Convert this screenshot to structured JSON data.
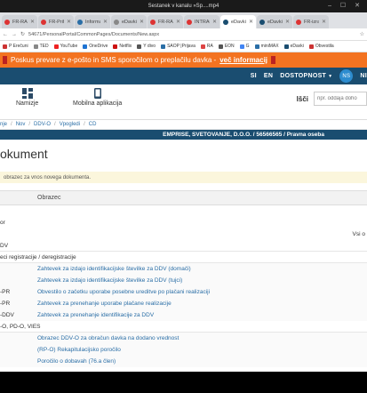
{
  "window": {
    "title": "Sestanek v kanalu »Sp....mp4",
    "controls": "– ☐ ✕"
  },
  "tabs": [
    {
      "label": "FR-RAČUNOVO",
      "color": "#d33",
      "active": false
    },
    {
      "label": "FR-Prihod",
      "color": "#d33",
      "active": false
    },
    {
      "label": "Informacije",
      "color": "#2a6ea6",
      "active": false
    },
    {
      "label": "eDavki.jpg",
      "color": "#888",
      "active": false
    },
    {
      "label": "FR-RAČUN",
      "color": "#d33",
      "active": false
    },
    {
      "label": "INTRACOM",
      "color": "#d33",
      "active": false
    },
    {
      "label": "eDavki - Nov",
      "color": "#1a4d70",
      "active": true
    },
    {
      "label": "eDavki - Nov",
      "color": "#1a4d70",
      "active": false
    },
    {
      "label": "FR-izračun P",
      "color": "#d33",
      "active": false
    }
  ],
  "address": {
    "url": "54671/PersonalPortal/CommonPages/Documents/New.aspx"
  },
  "bookmarks": [
    {
      "label": "P Erečuni",
      "color": "#c33"
    },
    {
      "label": "TED",
      "color": "#888"
    },
    {
      "label": "YouTube",
      "color": "#e22"
    },
    {
      "label": "OneDrive",
      "color": "#1e73d2"
    },
    {
      "label": "Netflix",
      "color": "#c11"
    },
    {
      "label": "Y divo",
      "color": "#555"
    },
    {
      "label": "SAOP |Prijava",
      "color": "#2a6ea6"
    },
    {
      "label": "RA",
      "color": "#d44"
    },
    {
      "label": "EON",
      "color": "#555"
    },
    {
      "label": "G",
      "color": "#4285f4"
    },
    {
      "label": "miniMAX",
      "color": "#2a6ea6"
    },
    {
      "label": "eDavki",
      "color": "#1a4d70"
    },
    {
      "label": "Obvestila",
      "color": "#c33"
    }
  ],
  "banner": {
    "text": "Poskus prevare z e-pošto in SMS sporočilom o preplačilu davka -",
    "link": "več informacij"
  },
  "navbar": {
    "items": [
      "SI",
      "EN",
      "DOSTOPNOST"
    ],
    "avatar": "NS",
    "trailing": "NI"
  },
  "toolbar": {
    "items": [
      {
        "label": "Namizje",
        "icon": "dashboard-icon"
      },
      {
        "label": "Mobilna aplikacija",
        "icon": "mobile-app-icon"
      }
    ]
  },
  "search": {
    "label": "Išči",
    "placeholder": "npr. oddaja doho"
  },
  "breadcrumb": [
    "nje",
    "Nov",
    "DDV-O",
    "Vpogledi",
    "CD"
  ],
  "company": "EMPRISE, SVETOVANJE, D.O.O. / 56566565 / Pravna oseba",
  "page": {
    "title": "okument",
    "notice": "obrazec za vnos novega dokumenta.",
    "column_header": "Obrazec"
  },
  "rows": [
    {
      "c1": "",
      "c2": "",
      "c3": "",
      "type": "plain"
    },
    {
      "c1": "or",
      "c2": "",
      "c3": "",
      "type": "plain"
    },
    {
      "c1": "",
      "c2": "",
      "c3": "Vsi o",
      "type": "plain"
    },
    {
      "c1": "DV",
      "c2": "",
      "c3": "",
      "type": "group"
    },
    {
      "c1": "eci registracije / deregistracije",
      "c2": "",
      "c3": "",
      "type": "group"
    },
    {
      "c1": "",
      "c2": "Zahtevek za izdajo identifikacijske številke za DDV (domači)",
      "c3": "",
      "type": "sub"
    },
    {
      "c1": "",
      "c2": "Zahtevek za izdajo identifikacijske številke za DDV (tujci)",
      "c3": "",
      "type": "sub"
    },
    {
      "c1": "-PR",
      "c2": "Obvestilo o začetku uporabe posebne ureditve po plačani realizaciji",
      "c3": "",
      "type": "sub"
    },
    {
      "c1": "-PR",
      "c2": "Zahtevek za prenehanje uporabe plačane realizacije",
      "c3": "",
      "type": "sub"
    },
    {
      "c1": "-DDV",
      "c2": "Zahtevek za prenehanje identifikacije za DDV",
      "c3": "",
      "type": "sub"
    },
    {
      "c1": "-O, PD-O, VIES",
      "c2": "",
      "c3": "",
      "type": "group"
    },
    {
      "c1": "",
      "c2": "Obrazec DDV-O za obračun davka na dodano vrednost",
      "c3": "",
      "type": "sub"
    },
    {
      "c1": "",
      "c2": "(RP-O) Rekapitulacijsko poročilo",
      "c3": "",
      "type": "sub"
    },
    {
      "c1": "",
      "c2": "Poročilo o dobavah (76.a člen)",
      "c3": "",
      "type": "sub"
    }
  ]
}
